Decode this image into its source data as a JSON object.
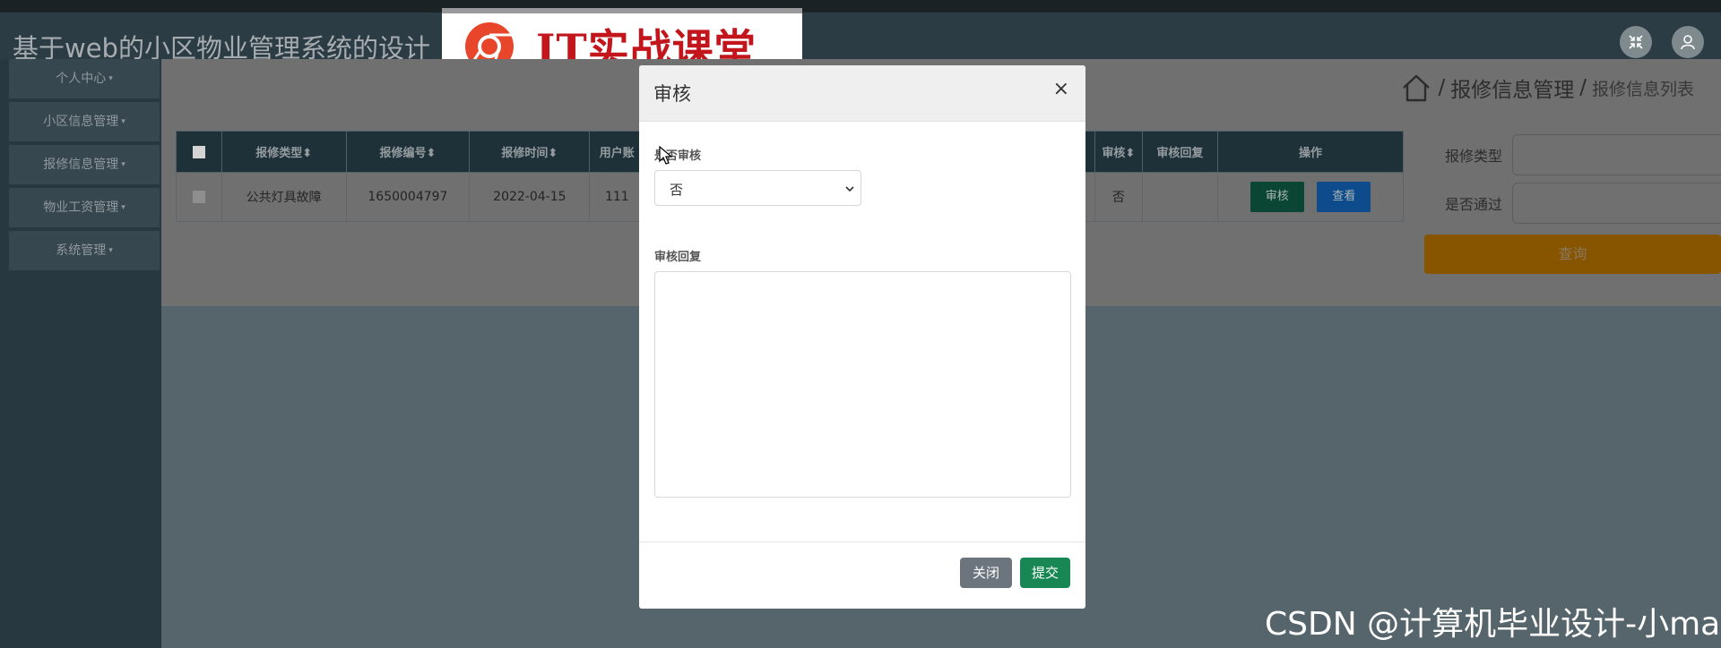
{
  "app": {
    "title": "基于web的小区物业管理系统的设计"
  },
  "logo": {
    "text": "IT实战课堂"
  },
  "header": {
    "icons": [
      "fullscreen-exit-icon",
      "user-icon"
    ]
  },
  "sidebar": {
    "items": [
      {
        "label": "个人中心"
      },
      {
        "label": "小区信息管理"
      },
      {
        "label": "报修信息管理"
      },
      {
        "label": "物业工资管理"
      },
      {
        "label": "系统管理"
      }
    ]
  },
  "breadcrumb": {
    "section": "报修信息管理",
    "separator": "/",
    "page": "报修信息列表"
  },
  "table": {
    "headers": [
      "报修类型",
      "报修编号",
      "报修时间",
      "用户账",
      "审核",
      "审核回复",
      "操作"
    ],
    "rows": [
      {
        "type": "公共灯具故障",
        "code": "1650004797",
        "time": "2022-04-15",
        "user": "111",
        "audit": "否",
        "reply": ""
      }
    ],
    "actions": {
      "audit": "审核",
      "view": "查看"
    }
  },
  "filters": {
    "type_label": "报修类型",
    "pass_label": "是否通过",
    "type_value": "",
    "pass_value": "",
    "query": "查询"
  },
  "modal": {
    "title": "审核",
    "close_glyph": "×",
    "field_audit_label": "是否审核",
    "field_audit_value": "否",
    "field_reply_label": "审核回复",
    "field_reply_value": "",
    "cancel": "关闭",
    "submit": "提交"
  },
  "watermark": "CSDN @计算机毕业设计-小ma",
  "colors": {
    "sidebar_bg": "#283840",
    "header_bg": "#2c3c45",
    "audit_button": "#0e6b4e",
    "view_button": "#146fd0",
    "query_button": "#875500",
    "close_button": "#6c757d",
    "submit_button": "#198754"
  }
}
